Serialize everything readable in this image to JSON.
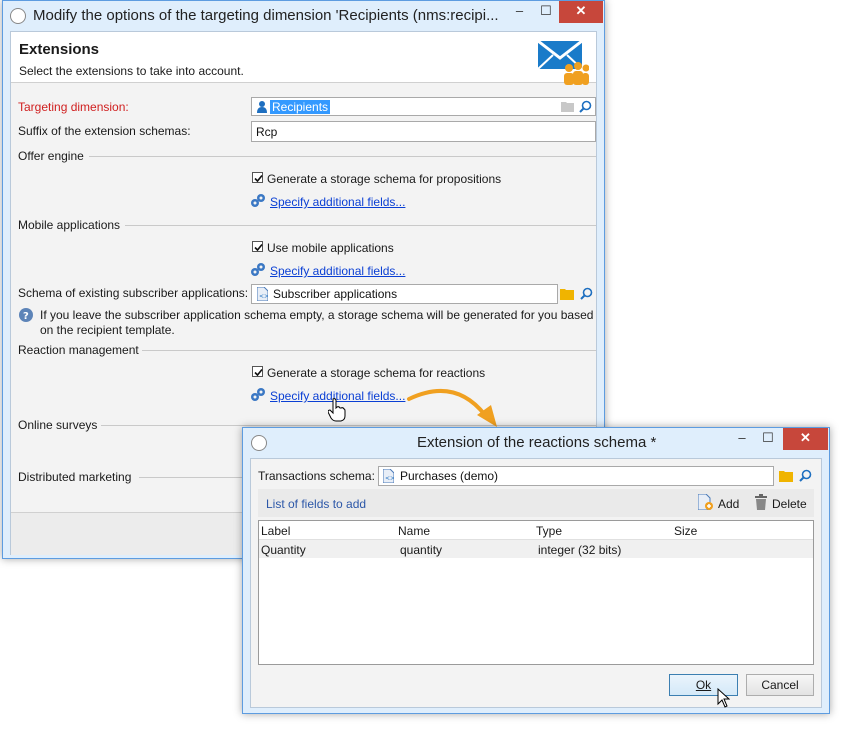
{
  "main_window": {
    "title": "Modify the options of the targeting dimension 'Recipients (nms:recipi...",
    "controls": {
      "minimize": "–",
      "maximize": "☐",
      "close": "✕"
    },
    "header": {
      "title": "Extensions",
      "subtitle": "Select the extensions to take into account."
    },
    "targeting_dimension": {
      "label": "Targeting dimension:",
      "value": "Recipients"
    },
    "suffix": {
      "label": "Suffix of the extension schemas:",
      "value": "Rcp"
    },
    "offer_engine": {
      "section": "Offer engine",
      "checkbox_label": "Generate a storage schema for propositions",
      "checked": true,
      "link": "Specify additional fields..."
    },
    "mobile_applications": {
      "section": "Mobile applications",
      "checkbox_label": "Use mobile applications",
      "checked": true,
      "link": "Specify additional fields...",
      "schema_label": "Schema of existing subscriber applications:",
      "schema_value": "Subscriber applications",
      "info_line1": "If you leave the subscriber application schema empty, a storage schema will be generated for you based",
      "info_line2": "on the recipient template."
    },
    "reaction_management": {
      "section": "Reaction management",
      "checkbox_label": "Generate a storage schema for reactions",
      "checked": true,
      "link": "Specify additional fields..."
    },
    "online_surveys": {
      "section": "Online surveys"
    },
    "distributed_marketing": {
      "section": "Distributed marketing"
    }
  },
  "dialog": {
    "title": "Extension of the reactions schema *",
    "controls": {
      "minimize": "–",
      "maximize": "☐",
      "close": "✕"
    },
    "transactions_schema": {
      "label": "Transactions schema:",
      "value": "Purchases (demo)"
    },
    "list_title": "List of fields to add",
    "add_label": "Add",
    "delete_label": "Delete",
    "table": {
      "columns": [
        "Label",
        "Name",
        "Type",
        "Size"
      ],
      "rows": [
        {
          "label": "Quantity",
          "name": "quantity",
          "type": "integer (32 bits)",
          "size": ""
        }
      ]
    },
    "ok_label": "Ok",
    "cancel_label": "Cancel"
  },
  "colors": {
    "accent_arrow": "#f0a020",
    "link": "#0a3fd4",
    "required_label": "#d02020",
    "selection": "#3399ff"
  }
}
